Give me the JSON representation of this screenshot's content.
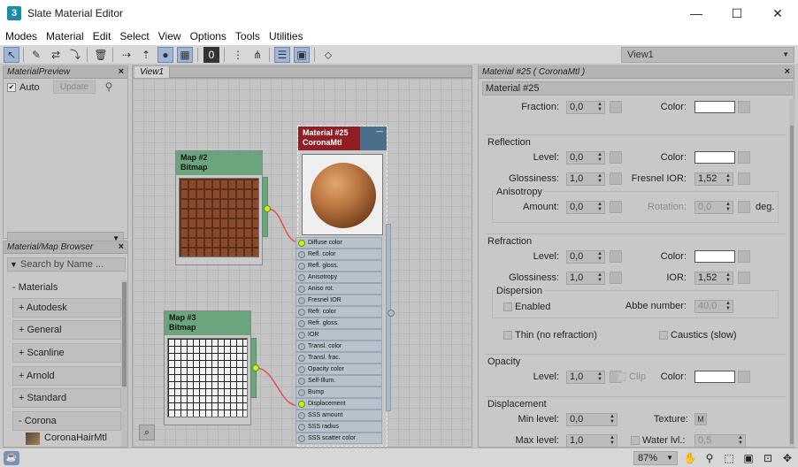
{
  "window": {
    "title": "Slate Material Editor",
    "app_icon_letter": "3",
    "minimize": "—",
    "maximize": "☐",
    "close": "✕"
  },
  "menu": [
    "Modes",
    "Material",
    "Edit",
    "Select",
    "View",
    "Options",
    "Tools",
    "Utilities"
  ],
  "toolbar": {
    "view_selector": "View1"
  },
  "material_preview": {
    "title": "MaterialPreview",
    "auto_label": "Auto",
    "update_label": "Update"
  },
  "browser": {
    "title": "Material/Map Browser",
    "search_placeholder": "Search by Name ...",
    "section": "- Materials",
    "groups": [
      "+ Autodesk",
      "+ General",
      "+ Scanline",
      "+ Arnold",
      "+ Standard"
    ],
    "corona": "- Corona",
    "corona_item": "CoronaHairMtl"
  },
  "view": {
    "tab": "View1"
  },
  "nodes": {
    "map2": {
      "name": "Map #2",
      "type": "Bitmap"
    },
    "map3": {
      "name": "Map #3",
      "type": "Bitmap"
    },
    "mat25": {
      "name": "Material #25",
      "type": "CoronaMtl",
      "minus": "—"
    },
    "slots": [
      "Diffuse color",
      "Refl. color",
      "Refl. gloss.",
      "Anisotropy",
      "Aniso rot.",
      "Fresnel IOR",
      "Refr. color",
      "Refr. gloss.",
      "IOR",
      "Transl. color",
      "Transl. frac.",
      "Opacity color",
      "Self-Illum.",
      "Bump",
      "Displacement",
      "SSS amount",
      "SSS radius",
      "SSS scatter color"
    ]
  },
  "props": {
    "title": "Material #25  ( CoronaMtl )",
    "name_field": "Material #25",
    "fraction": {
      "label": "Fraction:",
      "value": "0,0",
      "color_label": "Color:"
    },
    "reflection": {
      "title": "Reflection",
      "level_label": "Level:",
      "level": "0,0",
      "color_label": "Color:",
      "gloss_label": "Glossiness:",
      "gloss": "1,0",
      "fresnel_label": "Fresnel IOR:",
      "fresnel": "1,52"
    },
    "anisotropy": {
      "title": "Anisotropy",
      "amount_label": "Amount:",
      "amount": "0,0",
      "rotation_label": "Rotation:",
      "rotation": "0,0",
      "deg": "deg."
    },
    "refraction": {
      "title": "Refraction",
      "level_label": "Level:",
      "level": "0,0",
      "color_label": "Color:",
      "gloss_label": "Glossiness:",
      "gloss": "1,0",
      "ior_label": "IOR:",
      "ior": "1,52"
    },
    "dispersion": {
      "title": "Dispersion",
      "enabled_label": "Enabled",
      "abbe_label": "Abbe number:",
      "abbe": "40,0"
    },
    "thin_label": "Thin (no refraction)",
    "caustics_label": "Caustics (slow)",
    "opacity": {
      "title": "Opacity",
      "level_label": "Level:",
      "level": "1,0",
      "clip_label": "Clip",
      "color_label": "Color:"
    },
    "displacement": {
      "title": "Displacement",
      "min_label": "Min level:",
      "min": "0,0",
      "texture_label": "Texture:",
      "texture_btn": "M",
      "max_label": "Max level:",
      "max": "1,0",
      "water_label": "Water lvl.:",
      "water": "0,5"
    }
  },
  "status": {
    "zoom": "87%"
  }
}
